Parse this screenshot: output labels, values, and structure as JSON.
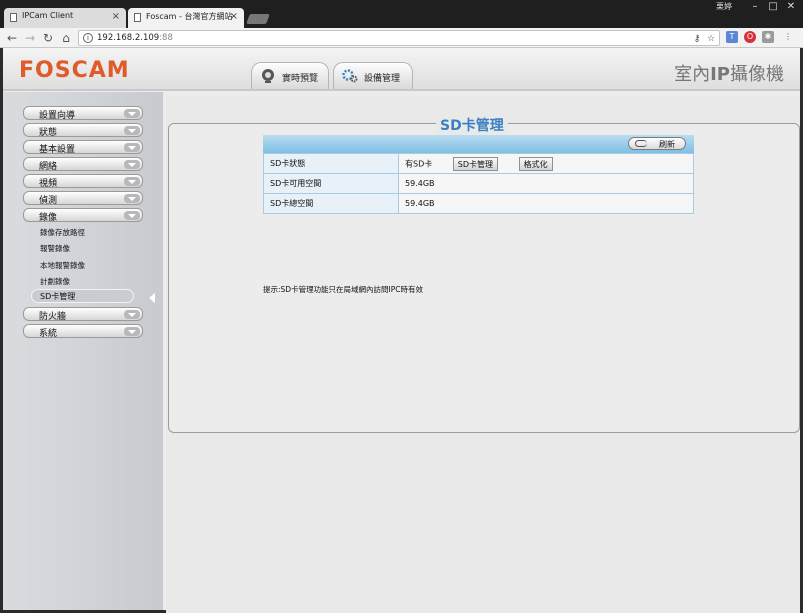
{
  "browser": {
    "tabs": [
      {
        "title": "IPCam Client",
        "active": false
      },
      {
        "title": "Foscam - 台灣官方網站",
        "active": true
      }
    ],
    "window_user": "栗婷",
    "window_controls": {
      "minimize": "–",
      "maximize": "□",
      "close": "✕"
    },
    "url_host": "192.168.2.109",
    "url_port": ":88",
    "icons": [
      "back-icon",
      "forward-icon",
      "reload-icon",
      "home-icon",
      "info-icon",
      "key-icon",
      "star-icon",
      "translate-icon",
      "opera-icon",
      "extension-icon",
      "menu-icon"
    ]
  },
  "header": {
    "logo": "FOSCAM",
    "product_title_prefix": "室內",
    "product_title_bold": "IP",
    "product_title_suffix": "攝像機",
    "tabs": [
      {
        "label": "實時預覽",
        "icon": "camera-icon"
      },
      {
        "label": "設備管理",
        "icon": "gear-icon"
      }
    ]
  },
  "sidebar": {
    "items": [
      {
        "label": "設置向導"
      },
      {
        "label": "狀態"
      },
      {
        "label": "基本設置"
      },
      {
        "label": "網絡"
      },
      {
        "label": "視頻"
      },
      {
        "label": "偵測"
      },
      {
        "label": "錄像"
      },
      {
        "label": "防火牆"
      },
      {
        "label": "系統"
      }
    ],
    "recording_sub": [
      "錄像存放路徑",
      "報警錄像",
      "本地報警錄像",
      "計劃錄像"
    ],
    "active_sub": "SD卡管理"
  },
  "main": {
    "title": "SD卡管理",
    "refresh_label": "刷新",
    "rows": [
      {
        "label": "SD卡狀態",
        "value": "有SD卡",
        "buttons": [
          "SD卡管理",
          "格式化"
        ]
      },
      {
        "label": "SD卡可用空間",
        "value": "59.4GB"
      },
      {
        "label": "SD卡總空間",
        "value": "59.4GB"
      }
    ],
    "hint": "提示:SD卡管理功能只在局域網內訪問IPC時有效"
  },
  "colors": {
    "accent": "#3a7fc1",
    "logo": "#e05a2a",
    "bar": "#7fbfe5"
  }
}
